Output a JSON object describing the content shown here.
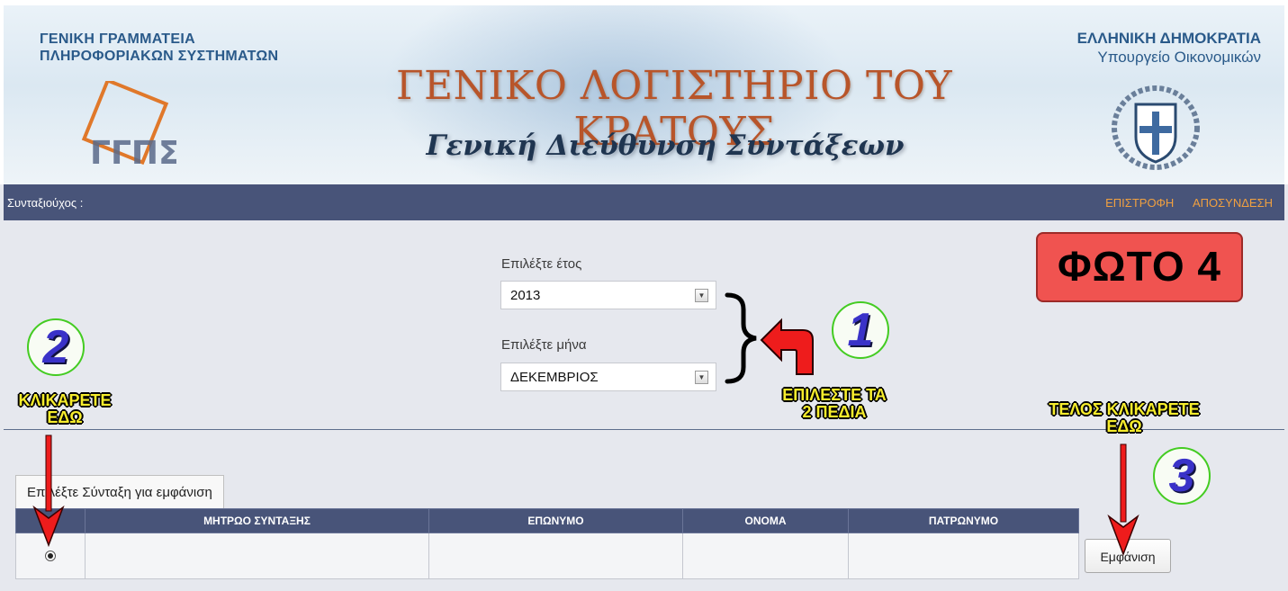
{
  "header": {
    "org_left_line1": "ΓΕΝΙΚΗ ΓΡΑΜΜΑΤΕΙΑ",
    "org_left_line2": "ΠΛΗΡΟΦΟΡΙΑΚΩΝ ΣΥΣΤΗΜΑΤΩΝ",
    "org_right_line1": "ΕΛΛΗΝΙΚΗ ΔΗΜΟΚΡΑΤΙΑ",
    "org_right_line2": "Υπουργείο Οικονομικών",
    "title": "ΓΕΝΙΚΟ ΛΟΓΙΣΤΗΡΙΟ ΤΟΥ ΚΡΑΤΟΥΣ",
    "subtitle": "Γενική Διεύθυνση Συντάξεων",
    "logo_text": "ΓΓΠΣ"
  },
  "navbar": {
    "user_label": "Συνταξιούχος :",
    "return_link": "ΕΠΙΣΤΡΟΦΗ",
    "logout_link": "ΑΠΟΣΥΝΔΕΣΗ",
    "link_color": "#f0a040",
    "bg_color": "#485479"
  },
  "form": {
    "year_label": "Επιλέξτε έτος",
    "year_value": "2013",
    "month_label": "Επιλέξτε μήνα",
    "month_value": "ΔΕΚΕΜΒΡΙΟΣ"
  },
  "results": {
    "tab_label": "Επιλέξτε Σύνταξη για εμφάνιση",
    "columns": [
      "ΜΗΤΡΩΟ ΣΥΝΤΑΞΗΣ",
      "ΕΠΩΝΥΜΟ",
      "ΟΝΟΜΑ",
      "ΠΑΤΡΩΝΥΜΟ"
    ],
    "rows": [
      {
        "selected": true,
        "registry": "",
        "surname": "",
        "name": "",
        "fathers_name": ""
      }
    ],
    "show_button": "Εμφάνιση"
  },
  "annotations": {
    "photo_badge": "ΦΩΤΟ 4",
    "step1_number": "1",
    "step1_text_line1": "ΕΠΙΛΕΣΤΕ ΤΑ",
    "step1_text_line2": "2 ΠΕΔΙΑ",
    "step2_number": "2",
    "step2_text_line1": "ΚΛΙΚΑΡΕΤΕ",
    "step2_text_line2": "ΕΔΩ",
    "step3_number": "3",
    "step3_text_line1": "ΤΕΛΟΣ ΚΛΙΚΑΡΕΤΕ",
    "step3_text_line2": "ΕΔΩ"
  }
}
